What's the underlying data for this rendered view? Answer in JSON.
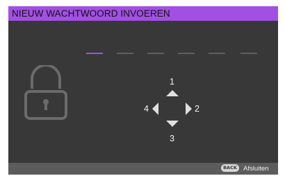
{
  "window": {
    "title": "NIEUW WACHTWOORD INVOEREN"
  },
  "colors": {
    "accent": "#a24fe3",
    "panel_background": "#383838",
    "footer_background": "#5c5c5c",
    "inactive_slot": "#5f5f5f"
  },
  "password": {
    "slot_count": 6,
    "active_slot_index": 0
  },
  "icons": {
    "lock": "padlock-icon",
    "up": "triangle-up-icon",
    "right": "triangle-right-icon",
    "down": "triangle-down-icon",
    "left": "triangle-left-icon"
  },
  "navigation": {
    "up_label": "1",
    "right_label": "2",
    "down_label": "3",
    "left_label": "4"
  },
  "footer": {
    "back_button_label": "BACK",
    "exit_label": "Afsluiten"
  }
}
